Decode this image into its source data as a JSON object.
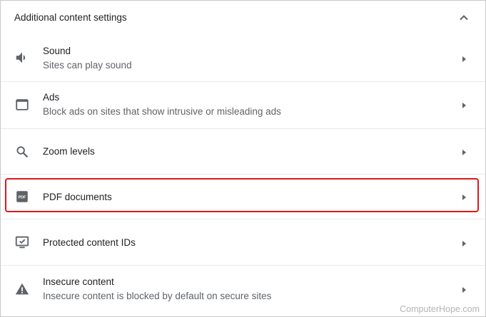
{
  "section": {
    "title": "Additional content settings",
    "toggle_icon": "chevron-up-icon"
  },
  "rows": [
    {
      "label": "Sound",
      "description": "Sites can play sound",
      "icon": "speaker-icon"
    },
    {
      "label": "Ads",
      "description": "Block ads on sites that show intrusive or misleading ads",
      "icon": "browser-window-icon"
    },
    {
      "label": "Zoom levels",
      "description": "",
      "icon": "search-icon"
    },
    {
      "label": "PDF documents",
      "description": "",
      "icon": "pdf-icon",
      "icon_text": "PDF",
      "highlighted": true
    },
    {
      "label": "Protected content IDs",
      "description": "",
      "icon": "protected-content-icon"
    },
    {
      "label": "Insecure content",
      "description": "Insecure content is blocked by default on secure sites",
      "icon": "warning-icon"
    }
  ],
  "watermark": "ComputerHope.com",
  "colors": {
    "highlight": "#e0161b",
    "icon": "#5f6368",
    "divider": "#e8eaed",
    "secondary_text": "#5f6368"
  }
}
